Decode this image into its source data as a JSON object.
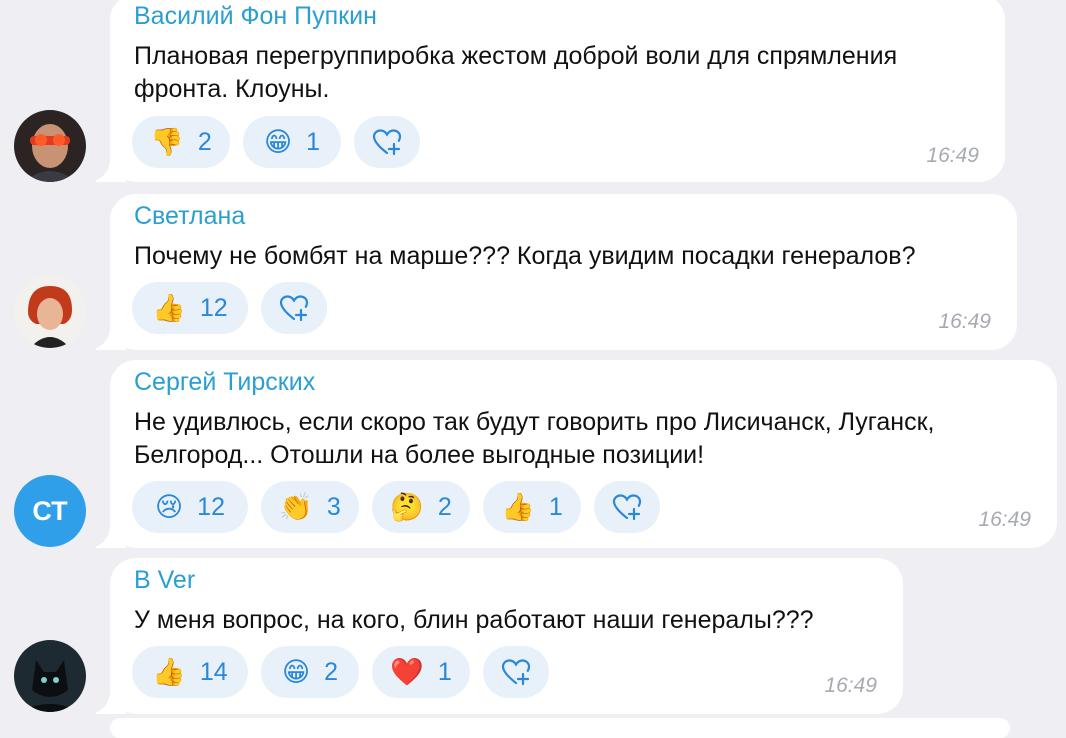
{
  "messages": [
    {
      "author": "Василий Фон Пупкин",
      "lines": [
        "Плановая перегруппиробка жестом доброй воли для спрямления",
        "фронта. Клоуны."
      ],
      "reactions": [
        {
          "icon": "thumbs-down-emoji",
          "glyph": "👎",
          "count": "2"
        },
        {
          "icon": "grinning-emoji",
          "glyph": "😁",
          "count": "1"
        }
      ],
      "time": "16:49"
    },
    {
      "author": "Светлана",
      "lines": [
        "Почему не бомбят на марше??? Когда увидим посадки генералов?"
      ],
      "reactions": [
        {
          "icon": "thumbs-up-emoji",
          "glyph": "👍",
          "count": "12"
        }
      ],
      "time": "16:49"
    },
    {
      "author": "Сергей Тирских",
      "avatar_initials": "СТ",
      "lines": [
        "Не удивлюсь, если скоро так будут говорить про Лисичанск, Луганск,",
        "Белгород... Отошли на более выгодные позиции!"
      ],
      "reactions": [
        {
          "icon": "crying-emoji",
          "glyph": "😢",
          "count": "12"
        },
        {
          "icon": "clapping-hands-emoji",
          "glyph": "👏",
          "count": "3"
        },
        {
          "icon": "thinking-emoji",
          "glyph": "🤔",
          "count": "2"
        },
        {
          "icon": "thumbs-up-emoji",
          "glyph": "👍",
          "count": "1"
        }
      ],
      "time": "16:49"
    },
    {
      "author": "В Ver",
      "lines": [
        "У меня вопрос, на кого, блин работают наши генералы???"
      ],
      "reactions": [
        {
          "icon": "thumbs-up-emoji",
          "glyph": "👍",
          "count": "14"
        },
        {
          "icon": "grinning-emoji",
          "glyph": "😁",
          "count": "2"
        },
        {
          "icon": "red-heart-emoji",
          "glyph": "❤️",
          "count": "1"
        }
      ],
      "time": "16:49"
    }
  ],
  "colors": {
    "background": "#efeff3",
    "author": "#2a9fd0",
    "reaction_bg": "#e8f1f9",
    "reaction_text": "#2b88d8",
    "time": "#a7aab0",
    "avatar_ct": "#2f9fea"
  },
  "add_reaction_icon": "heart-plus-icon"
}
